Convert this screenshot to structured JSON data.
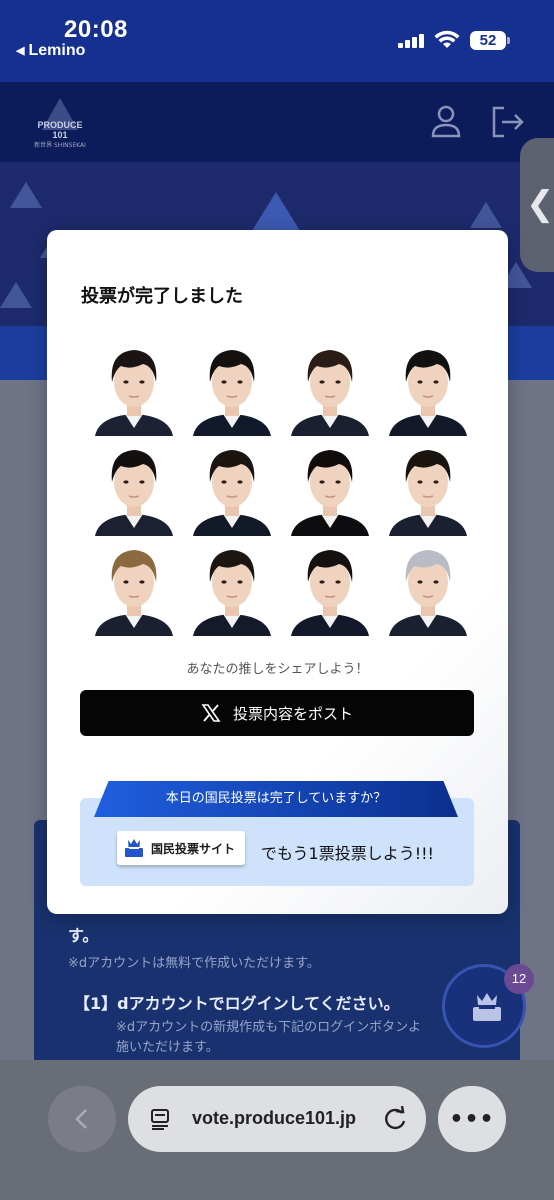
{
  "status_bar": {
    "time": "20:08",
    "back_app": "Lemino",
    "battery": "52"
  },
  "site": {
    "logo_text": "PRODUCE 101",
    "logo_sub": "新世界 SHINSEKAI"
  },
  "modal": {
    "title": "投票が完了しました",
    "photo_count": 12,
    "share_caption": "あなたの推しをシェアしよう！",
    "post_button": "投票内容をポスト",
    "vote_ribbon": "本日の国民投票は完了していますか？",
    "site_button": "国民投票サイト",
    "vote_more": "でもう1票投票しよう!!!"
  },
  "background": {
    "line1": "す。",
    "line2": "※dアカウントは無料で作成いただけます。",
    "line3": "【1】dアカウントでログインしてください。",
    "line4": "※dアカウントの新規作成も下記のログインボタンよ",
    "line5": "施いただけます。"
  },
  "fab": {
    "badge": "12"
  },
  "browser": {
    "url": "vote.produce101.jp"
  },
  "colors": {
    "accent": "#16308f",
    "ribbon": "#1f5fe0",
    "vote_box": "#cfe2fb"
  }
}
